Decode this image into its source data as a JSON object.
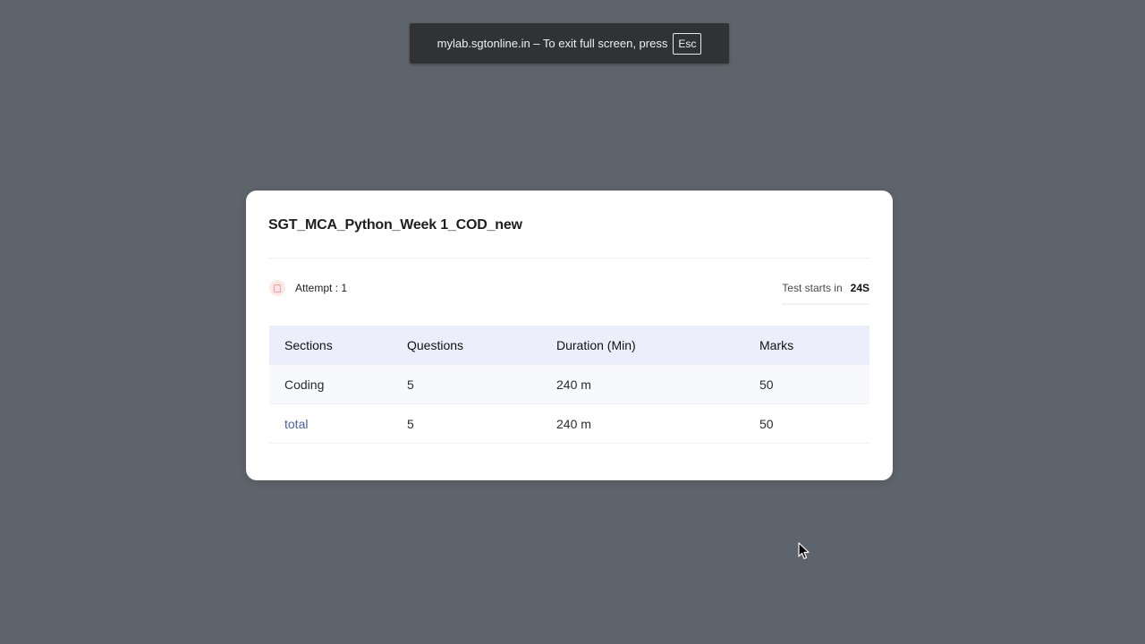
{
  "fullscreen_notice": {
    "text": "mylab.sgtonline.in – To exit full screen, press",
    "key": "Esc"
  },
  "test": {
    "title": "SGT_MCA_Python_Week 1_COD_new",
    "attempt_label": "Attempt : 1",
    "attempt_icon": "clipboard-icon",
    "timer_label": "Test starts in",
    "timer_value": "24S"
  },
  "table": {
    "headers": {
      "sections": "Sections",
      "questions": "Questions",
      "duration": "Duration (Min)",
      "marks": "Marks"
    },
    "rows": [
      {
        "section": "Coding",
        "questions": "5",
        "duration": "240 m",
        "marks": "50"
      }
    ],
    "total": {
      "section": "total",
      "questions": "5",
      "duration": "240 m",
      "marks": "50"
    }
  },
  "colors": {
    "backdrop": "#5e646b",
    "card": "#ffffff",
    "table_header": "#eceffb",
    "link": "#4a5fa8"
  }
}
